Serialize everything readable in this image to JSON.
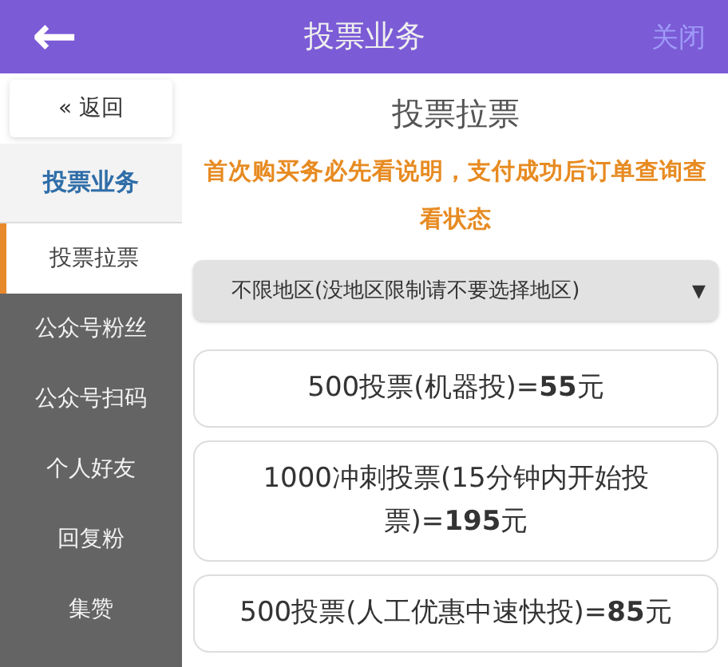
{
  "header": {
    "back": "←",
    "title": "投票业务",
    "close": "关闭"
  },
  "sidebar": {
    "back": "« 返回",
    "items": [
      {
        "label": "投票业务",
        "kind": "heading",
        "selected": false
      },
      {
        "label": "投票拉票",
        "kind": "item",
        "selected": true
      },
      {
        "label": "公众号粉丝",
        "kind": "item",
        "selected": false
      },
      {
        "label": "公众号扫码",
        "kind": "item",
        "selected": false
      },
      {
        "label": "个人好友",
        "kind": "item",
        "selected": false
      },
      {
        "label": "回复粉",
        "kind": "item",
        "selected": false
      },
      {
        "label": "集赞",
        "kind": "item",
        "selected": false
      }
    ]
  },
  "main": {
    "title": "投票拉票",
    "notice": "首次购买务必先看说明，支付成功后订单查询查看状态",
    "region": {
      "value": "不限地区(没地区限制请不要选择地区)",
      "caret": "▼"
    },
    "options": [
      {
        "label": "500投票(机器投)=**55**元"
      },
      {
        "label": "1000冲刺投票(15分钟内开始投票)=**195**元"
      },
      {
        "label": "500投票(人工优惠中速快投)=**85**元"
      }
    ]
  }
}
